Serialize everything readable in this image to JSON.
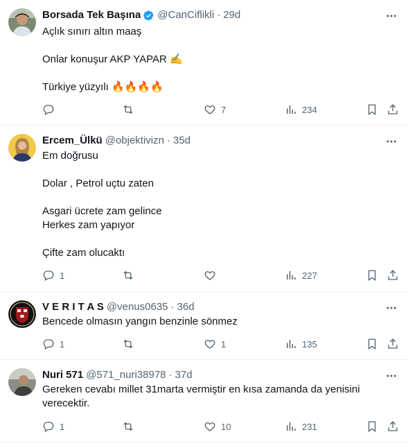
{
  "tweets": [
    {
      "name": "Borsada Tek Başına",
      "verified": true,
      "handle": "@CanCiflikli",
      "time": "29d",
      "lines": [
        "Açlık sınırı altın maaş",
        "",
        "Onlar konuşur AKP YAPAR ✍️",
        "",
        "Türkiye yüzyılı 🔥🔥🔥🔥"
      ],
      "replies": "",
      "retweets": "",
      "likes": "7",
      "views": "234"
    },
    {
      "name": "Ercem_Ülkü",
      "verified": false,
      "handle": "@objektivizn",
      "time": "35d",
      "lines": [
        "Em doğrusu",
        "",
        "Dolar , Petrol uçtu zaten",
        "",
        "Asgari ücrete zam gelince",
        "Herkes zam yapıyor",
        "",
        "Çifte zam olucaktı"
      ],
      "replies": "1",
      "retweets": "",
      "likes": "",
      "views": "227"
    },
    {
      "name": "V E R I T A S",
      "verified": false,
      "handle": "@venus0635",
      "time": "36d",
      "lines": [
        "Bencede olmasın yangın benzinle sönmez"
      ],
      "replies": "1",
      "retweets": "",
      "likes": "1",
      "views": "135"
    },
    {
      "name": "Nuri 571",
      "verified": false,
      "handle": "@571_nuri38978",
      "time": "37d",
      "lines": [
        "Gereken cevabı millet 31marta vermiştir en kısa zamanda da yenisini",
        "verecektir."
      ],
      "replies": "1",
      "retweets": "",
      "likes": "10",
      "views": "231"
    }
  ],
  "separator": "·",
  "colors": {
    "text": "#0f1419",
    "secondary": "#536471",
    "verified": "#1d9bf0",
    "divider": "#eff3f4"
  },
  "icons": [
    "more-icon",
    "reply-icon",
    "retweet-icon",
    "like-icon",
    "views-icon",
    "bookmark-icon",
    "share-icon",
    "verified-icon"
  ]
}
